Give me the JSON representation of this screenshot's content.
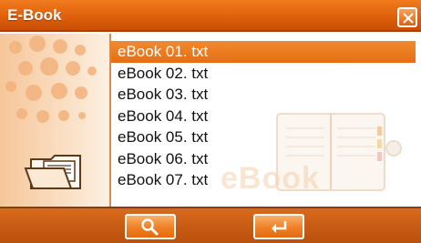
{
  "window": {
    "title": "E-Book"
  },
  "file_list": {
    "items": [
      {
        "label": "eBook 01. txt",
        "selected": true
      },
      {
        "label": "eBook 02. txt",
        "selected": false
      },
      {
        "label": "eBook 03. txt",
        "selected": false
      },
      {
        "label": "eBook 04. txt",
        "selected": false
      },
      {
        "label": "eBook 05. txt",
        "selected": false
      },
      {
        "label": "eBook 06. txt",
        "selected": false
      },
      {
        "label": "eBook 07. txt",
        "selected": false
      }
    ]
  },
  "watermark": {
    "text": "eBook"
  },
  "toolbar": {
    "search_icon": "search-icon",
    "enter_icon": "enter-icon"
  },
  "colors": {
    "accent": "#e56e12",
    "titlebar": "#e0600c",
    "selection": "#f28a30",
    "panel": "#fbe3ca"
  }
}
